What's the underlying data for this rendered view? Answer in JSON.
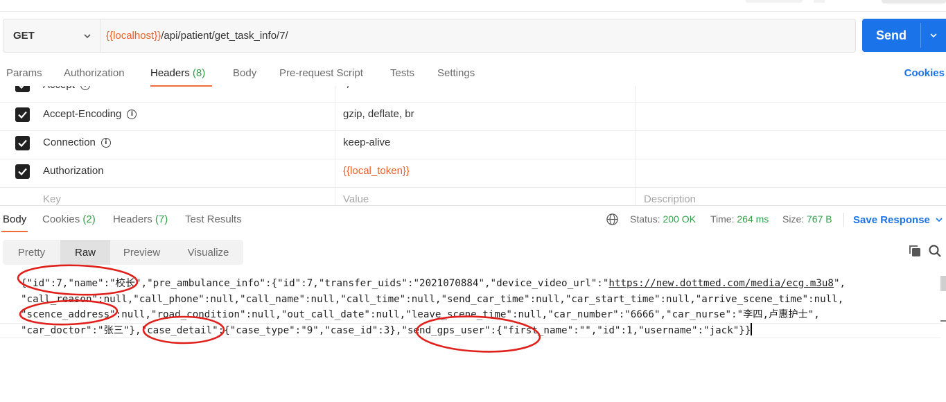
{
  "request": {
    "method": "GET",
    "url_var": "{{localhost}}",
    "url_path": "/api/patient/get_task_info/7/",
    "send_label": "Send"
  },
  "request_tabs": {
    "params": "Params",
    "authorization": "Authorization",
    "headers": "Headers",
    "headers_count": "(8)",
    "body": "Body",
    "prerequest": "Pre-request Script",
    "tests": "Tests",
    "settings": "Settings",
    "cookies": "Cookies"
  },
  "headers_table": {
    "rows": [
      {
        "key": "Accept",
        "value": "*/*"
      },
      {
        "key": "Accept-Encoding",
        "value": "gzip, deflate, br"
      },
      {
        "key": "Connection",
        "value": "keep-alive"
      },
      {
        "key": "Authorization",
        "value": "{{local_token}}"
      }
    ],
    "placeholders": {
      "key": "Key",
      "value": "Value",
      "description": "Description"
    }
  },
  "response_tabs": {
    "body": "Body",
    "cookies": "Cookies",
    "cookies_count": "(2)",
    "headers": "Headers",
    "headers_count": "(7)",
    "test_results": "Test Results"
  },
  "response_status": {
    "status_label": "Status:",
    "status_value": "200 OK",
    "time_label": "Time:",
    "time_value": "264 ms",
    "size_label": "Size:",
    "size_value": "767 B",
    "save_response": "Save Response"
  },
  "view_modes": {
    "pretty": "Pretty",
    "raw": "Raw",
    "preview": "Preview",
    "visualize": "Visualize"
  },
  "response_body": {
    "line1_a": "{\"id\":7,\"name\":\"校长\",\"pre_ambulance_info\":{\"id\":7,\"transfer_uids\":\"2021070884\",\"device_video_url\":\"",
    "line1_link": "https://new.dottmed.com/media/ecg.m3u8",
    "line1_b": "\",",
    "line2": "\"call_reason\":null,\"call_phone\":null,\"call_name\":null,\"call_time\":null,\"send_car_time\":null,\"car_start_time\":null,\"arrive_scene_time\":null,",
    "line3": "\"scence_address\":null,\"road_condition\":null,\"out_call_date\":null,\"leave_scene_time\":null,\"car_number\":\"6666\",\"car_nurse\":\"李四,卢惠护士\",",
    "line4": "\"car_doctor\":\"张三\"},\"case_detail\":{\"case_type\":\"9\",\"case_id\":3},\"send_gps_user\":{\"first_name\":\"\",\"id\":1,\"username\":\"jack\"}}"
  },
  "colors": {
    "accent_orange": "#f26b3a",
    "variable_orange": "#e8622a",
    "primary_blue": "#1a73e8",
    "success_green": "#2e9e48",
    "annotation_red": "#e0201b"
  }
}
